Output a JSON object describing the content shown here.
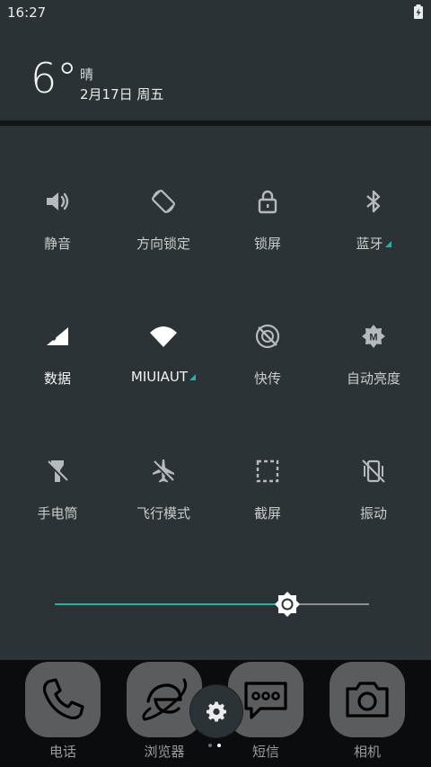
{
  "status_bar": {
    "time": "16:27"
  },
  "weather": {
    "temperature": "6°",
    "condition": "晴",
    "date": "2月17日 周五"
  },
  "quick_settings": {
    "tiles": [
      {
        "label": "静音",
        "icon": "volume-icon",
        "active": false
      },
      {
        "label": "方向锁定",
        "icon": "rotation-lock-icon",
        "active": false
      },
      {
        "label": "锁屏",
        "icon": "lock-icon",
        "active": false
      },
      {
        "label": "蓝牙",
        "icon": "bluetooth-icon",
        "active": false
      },
      {
        "label": "数据",
        "icon": "mobile-data-icon",
        "active": true
      },
      {
        "label": "MIUIAUT",
        "icon": "wifi-icon",
        "active": true
      },
      {
        "label": "快传",
        "icon": "fast-share-icon",
        "active": false
      },
      {
        "label": "自动亮度",
        "icon": "auto-brightness-icon",
        "active": false
      },
      {
        "label": "手电筒",
        "icon": "flashlight-icon",
        "active": false
      },
      {
        "label": "飞行模式",
        "icon": "airplane-icon",
        "active": false
      },
      {
        "label": "截屏",
        "icon": "screenshot-icon",
        "active": false
      },
      {
        "label": "振动",
        "icon": "vibrate-icon",
        "active": false
      }
    ],
    "brightness_level": 0.74
  },
  "dock": {
    "apps": [
      {
        "label": "电话",
        "icon": "phone-icon"
      },
      {
        "label": "浏览器",
        "icon": "browser-icon"
      },
      {
        "label": "短信",
        "icon": "sms-icon"
      },
      {
        "label": "相机",
        "icon": "camera-icon"
      }
    ],
    "page_count": 2,
    "current_page": 2
  },
  "colors": {
    "panel": "#2c3337",
    "accent": "#1fb5a0",
    "icon_inactive": "#b4babd",
    "icon_active": "#ffffff"
  }
}
